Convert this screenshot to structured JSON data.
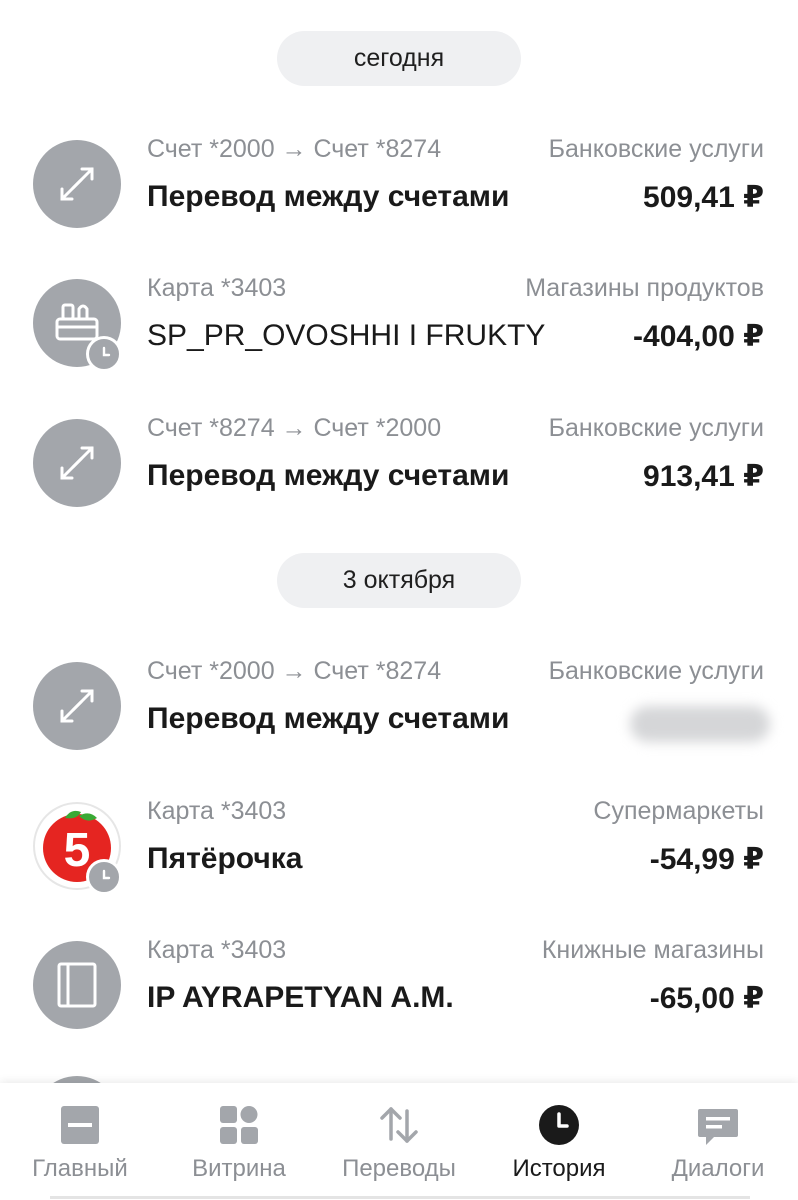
{
  "groups": [
    {
      "date": "сегодня"
    },
    {
      "date": "3 октября"
    }
  ],
  "transactions": [
    {
      "source": "Счет *2000 → Счет *8274",
      "category": "Банковские услуги",
      "title": "Перевод между счетами",
      "amount": "509,41 ₽",
      "icon": "transfer-arrows-icon"
    },
    {
      "source": "Карта *3403",
      "category": "Магазины продуктов",
      "title": "SP_PR_OVOSHHI I FRUKTY",
      "amount": "-404,00 ₽",
      "icon": "grocery-basket-icon",
      "pending": true
    },
    {
      "source": "Счет *8274 → Счет *2000",
      "category": "Банковские услуги",
      "title": "Перевод между счетами",
      "amount": "913,41 ₽",
      "icon": "transfer-arrows-icon"
    },
    {
      "source": "Счет *2000 → Счет *8274",
      "category": "Банковские услуги",
      "title": "Перевод между счетами",
      "amount": "",
      "amount_hidden": true,
      "icon": "transfer-arrows-icon"
    },
    {
      "source": "Карта *3403",
      "category": "Супермаркеты",
      "title": "Пятёрочка",
      "amount": "-54,99 ₽",
      "icon": "pyaterochka-logo-icon",
      "pending": true
    },
    {
      "source": "Карта *3403",
      "category": "Книжные магазины",
      "title": "IP AYRAPETYAN A.M.",
      "amount": "-65,00 ₽",
      "icon": "book-icon"
    }
  ],
  "nav": {
    "items": [
      {
        "label": "Главный",
        "icon": "home-card-icon"
      },
      {
        "label": "Витрина",
        "icon": "showcase-grid-icon"
      },
      {
        "label": "Переводы",
        "icon": "transfers-arrows-icon"
      },
      {
        "label": "История",
        "icon": "history-clock-icon",
        "active": true
      },
      {
        "label": "Диалоги",
        "icon": "chat-bubble-icon"
      }
    ]
  },
  "colors": {
    "icon_gray": "#a3a6ab",
    "pill_bg": "#eff0f2",
    "secondary_text": "#8c8f94",
    "primary_text": "#1a1a1a",
    "brand_red": "#e52521",
    "brand_green": "#3aa935"
  }
}
